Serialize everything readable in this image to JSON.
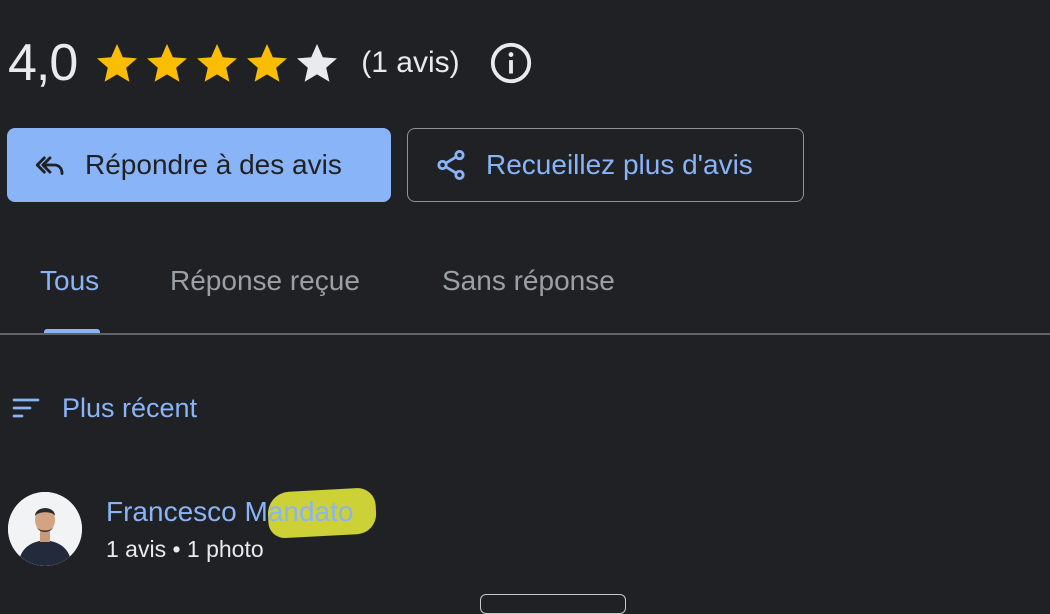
{
  "rating": {
    "value": "4,0",
    "stars_filled": 4,
    "stars_total": 5,
    "review_count": "(1 avis)",
    "info_icon": "info-icon"
  },
  "actions": {
    "reply_label": "Répondre à des avis",
    "reply_icon": "reply-all-icon",
    "collect_label": "Recueillez plus d'avis",
    "collect_icon": "share-icon"
  },
  "tabs": [
    {
      "label": "Tous",
      "active": true
    },
    {
      "label": "Réponse reçue",
      "active": false
    },
    {
      "label": "Sans réponse",
      "active": false
    }
  ],
  "sort": {
    "label": "Plus récent",
    "icon": "sort-icon"
  },
  "reviewer": {
    "name": "Francesco Mandato",
    "meta": "1 avis • 1 photo",
    "avatar": "avatar"
  },
  "colors": {
    "background": "#202124",
    "accent": "#8ab4f8",
    "star_filled": "#fbbc04",
    "star_empty": "#e8eaed",
    "text": "#e8eaed",
    "muted": "#9aa0a6",
    "highlight": "#ebf03c"
  }
}
